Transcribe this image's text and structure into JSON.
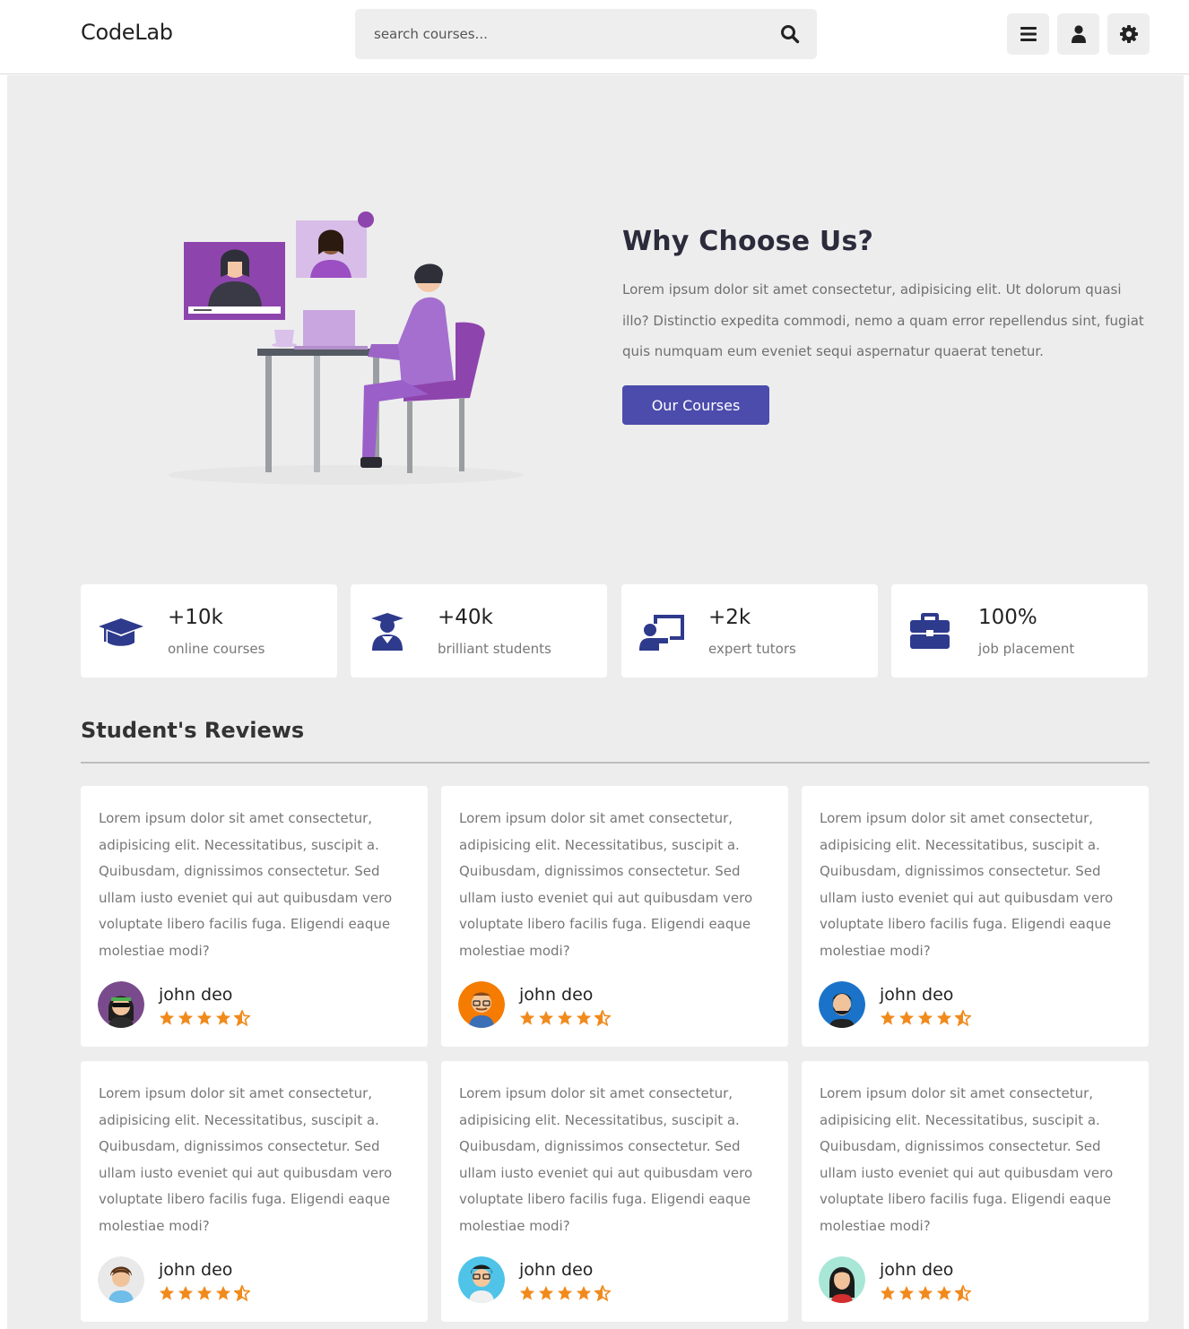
{
  "header": {
    "logo": "CodeLab",
    "search_placeholder": "search courses...",
    "icons": [
      "menu-icon",
      "user-icon",
      "settings-icon"
    ]
  },
  "hero": {
    "title": "Why Choose Us?",
    "text": "Lorem ipsum dolor sit amet consectetur, adipisicing elit. Ut dolorum quasi illo? Distinctio expedita commodi, nemo a quam error repellendus sint, fugiat quis numquam eum eveniet sequi aspernatur quaerat tenetur.",
    "button": "Our Courses"
  },
  "stats": [
    {
      "value": "+10k",
      "label": "online courses",
      "icon": "graduation-cap-icon"
    },
    {
      "value": "+40k",
      "label": "brilliant students",
      "icon": "user-graduate-icon"
    },
    {
      "value": "+2k",
      "label": "expert tutors",
      "icon": "chalkboard-teacher-icon"
    },
    {
      "value": "100%",
      "label": "job placement",
      "icon": "briefcase-icon"
    }
  ],
  "reviews_section": {
    "title": "Student's Reviews"
  },
  "reviews": [
    {
      "text": "Lorem ipsum dolor sit amet consectetur, adipisicing elit. Necessitatibus, suscipit a. Quibusdam, dignissimos consectetur. Sed ullam iusto eveniet qui aut quibusdam vero voluptate libero facilis fuga. Eligendi eaque molestiae modi?",
      "name": "john deo",
      "rating": 4.5
    },
    {
      "text": "Lorem ipsum dolor sit amet consectetur, adipisicing elit. Necessitatibus, suscipit a. Quibusdam, dignissimos consectetur. Sed ullam iusto eveniet qui aut quibusdam vero voluptate libero facilis fuga. Eligendi eaque molestiae modi?",
      "name": "john deo",
      "rating": 4.5
    },
    {
      "text": "Lorem ipsum dolor sit amet consectetur, adipisicing elit. Necessitatibus, suscipit a. Quibusdam, dignissimos consectetur. Sed ullam iusto eveniet qui aut quibusdam vero voluptate libero facilis fuga. Eligendi eaque molestiae modi?",
      "name": "john deo",
      "rating": 4.5
    },
    {
      "text": "Lorem ipsum dolor sit amet consectetur, adipisicing elit. Necessitatibus, suscipit a. Quibusdam, dignissimos consectetur. Sed ullam iusto eveniet qui aut quibusdam vero voluptate libero facilis fuga. Eligendi eaque molestiae modi?",
      "name": "john deo",
      "rating": 4.5
    },
    {
      "text": "Lorem ipsum dolor sit amet consectetur, adipisicing elit. Necessitatibus, suscipit a. Quibusdam, dignissimos consectetur. Sed ullam iusto eveniet qui aut quibusdam vero voluptate libero facilis fuga. Eligendi eaque molestiae modi?",
      "name": "john deo",
      "rating": 4.5
    },
    {
      "text": "Lorem ipsum dolor sit amet consectetur, adipisicing elit. Necessitatibus, suscipit a. Quibusdam, dignissimos consectetur. Sed ullam iusto eveniet qui aut quibusdam vero voluptate libero facilis fuga. Eligendi eaque molestiae modi?",
      "name": "john deo",
      "rating": 4.5
    }
  ],
  "colors": {
    "accent": "#4c4cad",
    "icon": "#2e3a8c",
    "star": "#f18a1c",
    "page_bg": "#ededed"
  }
}
